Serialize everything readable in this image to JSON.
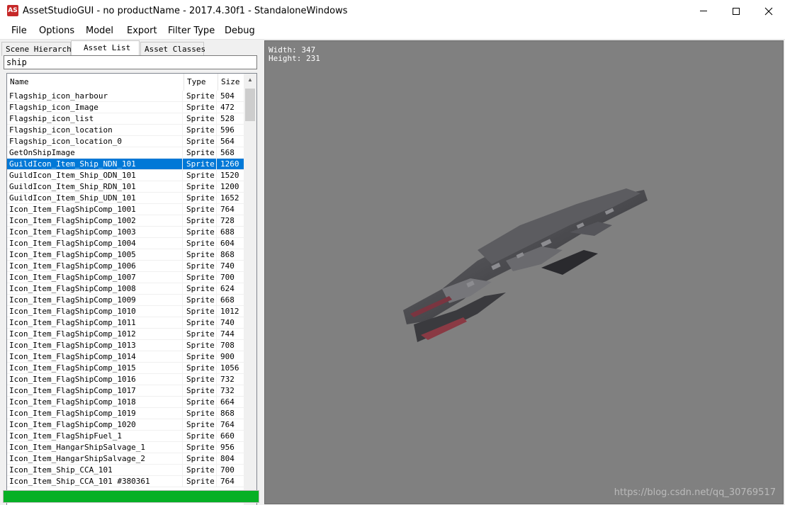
{
  "window": {
    "title": "AssetStudioGUI - no productName - 2017.4.30f1 - StandaloneWindows",
    "app_icon_text": "AS"
  },
  "menu": [
    {
      "label": "File"
    },
    {
      "label": "Options"
    },
    {
      "label": "Model"
    },
    {
      "label": "Export"
    },
    {
      "label": "Filter Type"
    },
    {
      "label": "Debug"
    }
  ],
  "tabs": [
    {
      "label": "Scene Hierarchy"
    },
    {
      "label": "Asset List"
    },
    {
      "label": "Asset Classes"
    }
  ],
  "active_tab": "Asset List",
  "search": {
    "value": "ship"
  },
  "columns": {
    "name": "Name",
    "type": "Type",
    "size": "Size"
  },
  "rows": [
    {
      "name": "Flagship_icon_harbour",
      "type": "Sprite",
      "size": "504"
    },
    {
      "name": "Flagship_icon_Image",
      "type": "Sprite",
      "size": "472"
    },
    {
      "name": "Flagship_icon_list",
      "type": "Sprite",
      "size": "528"
    },
    {
      "name": "Flagship_icon_location",
      "type": "Sprite",
      "size": "596"
    },
    {
      "name": "Flagship_icon_location_0",
      "type": "Sprite",
      "size": "564"
    },
    {
      "name": "GetOnShipImage",
      "type": "Sprite",
      "size": "568"
    },
    {
      "name": "GuildIcon_Item_Ship_NDN_101",
      "type": "Sprite",
      "size": "1260",
      "selected": true
    },
    {
      "name": "GuildIcon_Item_Ship_ODN_101",
      "type": "Sprite",
      "size": "1520"
    },
    {
      "name": "GuildIcon_Item_Ship_RDN_101",
      "type": "Sprite",
      "size": "1200"
    },
    {
      "name": "GuildIcon_Item_Ship_UDN_101",
      "type": "Sprite",
      "size": "1652"
    },
    {
      "name": "Icon_Item_FlagShipComp_1001",
      "type": "Sprite",
      "size": "764"
    },
    {
      "name": "Icon_Item_FlagShipComp_1002",
      "type": "Sprite",
      "size": "728"
    },
    {
      "name": "Icon_Item_FlagShipComp_1003",
      "type": "Sprite",
      "size": "688"
    },
    {
      "name": "Icon_Item_FlagShipComp_1004",
      "type": "Sprite",
      "size": "604"
    },
    {
      "name": "Icon_Item_FlagShipComp_1005",
      "type": "Sprite",
      "size": "868"
    },
    {
      "name": "Icon_Item_FlagShipComp_1006",
      "type": "Sprite",
      "size": "740"
    },
    {
      "name": "Icon_Item_FlagShipComp_1007",
      "type": "Sprite",
      "size": "700"
    },
    {
      "name": "Icon_Item_FlagShipComp_1008",
      "type": "Sprite",
      "size": "624"
    },
    {
      "name": "Icon_Item_FlagShipComp_1009",
      "type": "Sprite",
      "size": "668"
    },
    {
      "name": "Icon_Item_FlagShipComp_1010",
      "type": "Sprite",
      "size": "1012"
    },
    {
      "name": "Icon_Item_FlagShipComp_1011",
      "type": "Sprite",
      "size": "740"
    },
    {
      "name": "Icon_Item_FlagShipComp_1012",
      "type": "Sprite",
      "size": "744"
    },
    {
      "name": "Icon_Item_FlagShipComp_1013",
      "type": "Sprite",
      "size": "708"
    },
    {
      "name": "Icon_Item_FlagShipComp_1014",
      "type": "Sprite",
      "size": "900"
    },
    {
      "name": "Icon_Item_FlagShipComp_1015",
      "type": "Sprite",
      "size": "1056"
    },
    {
      "name": "Icon_Item_FlagShipComp_1016",
      "type": "Sprite",
      "size": "732"
    },
    {
      "name": "Icon_Item_FlagShipComp_1017",
      "type": "Sprite",
      "size": "732"
    },
    {
      "name": "Icon_Item_FlagShipComp_1018",
      "type": "Sprite",
      "size": "664"
    },
    {
      "name": "Icon_Item_FlagShipComp_1019",
      "type": "Sprite",
      "size": "868"
    },
    {
      "name": "Icon_Item_FlagShipComp_1020",
      "type": "Sprite",
      "size": "764"
    },
    {
      "name": "Icon_Item_FlagShipFuel_1",
      "type": "Sprite",
      "size": "660"
    },
    {
      "name": "Icon_Item_HangarShipSalvage_1",
      "type": "Sprite",
      "size": "956"
    },
    {
      "name": "Icon_Item_HangarShipSalvage_2",
      "type": "Sprite",
      "size": "804"
    },
    {
      "name": "Icon_Item_Ship_CCA_101",
      "type": "Sprite",
      "size": "700"
    },
    {
      "name": "Icon_Item_Ship_CCA_101 #380361",
      "type": "Sprite",
      "size": "764"
    }
  ],
  "progress": {
    "value": 1.0
  },
  "preview": {
    "width_text": "Width: 347",
    "height_text": "Height: 231"
  },
  "watermark": "https://blog.csdn.net/qq_30769517",
  "colors": {
    "selection": "#0078d7",
    "progress": "#06b025",
    "preview_bg": "#808080"
  }
}
